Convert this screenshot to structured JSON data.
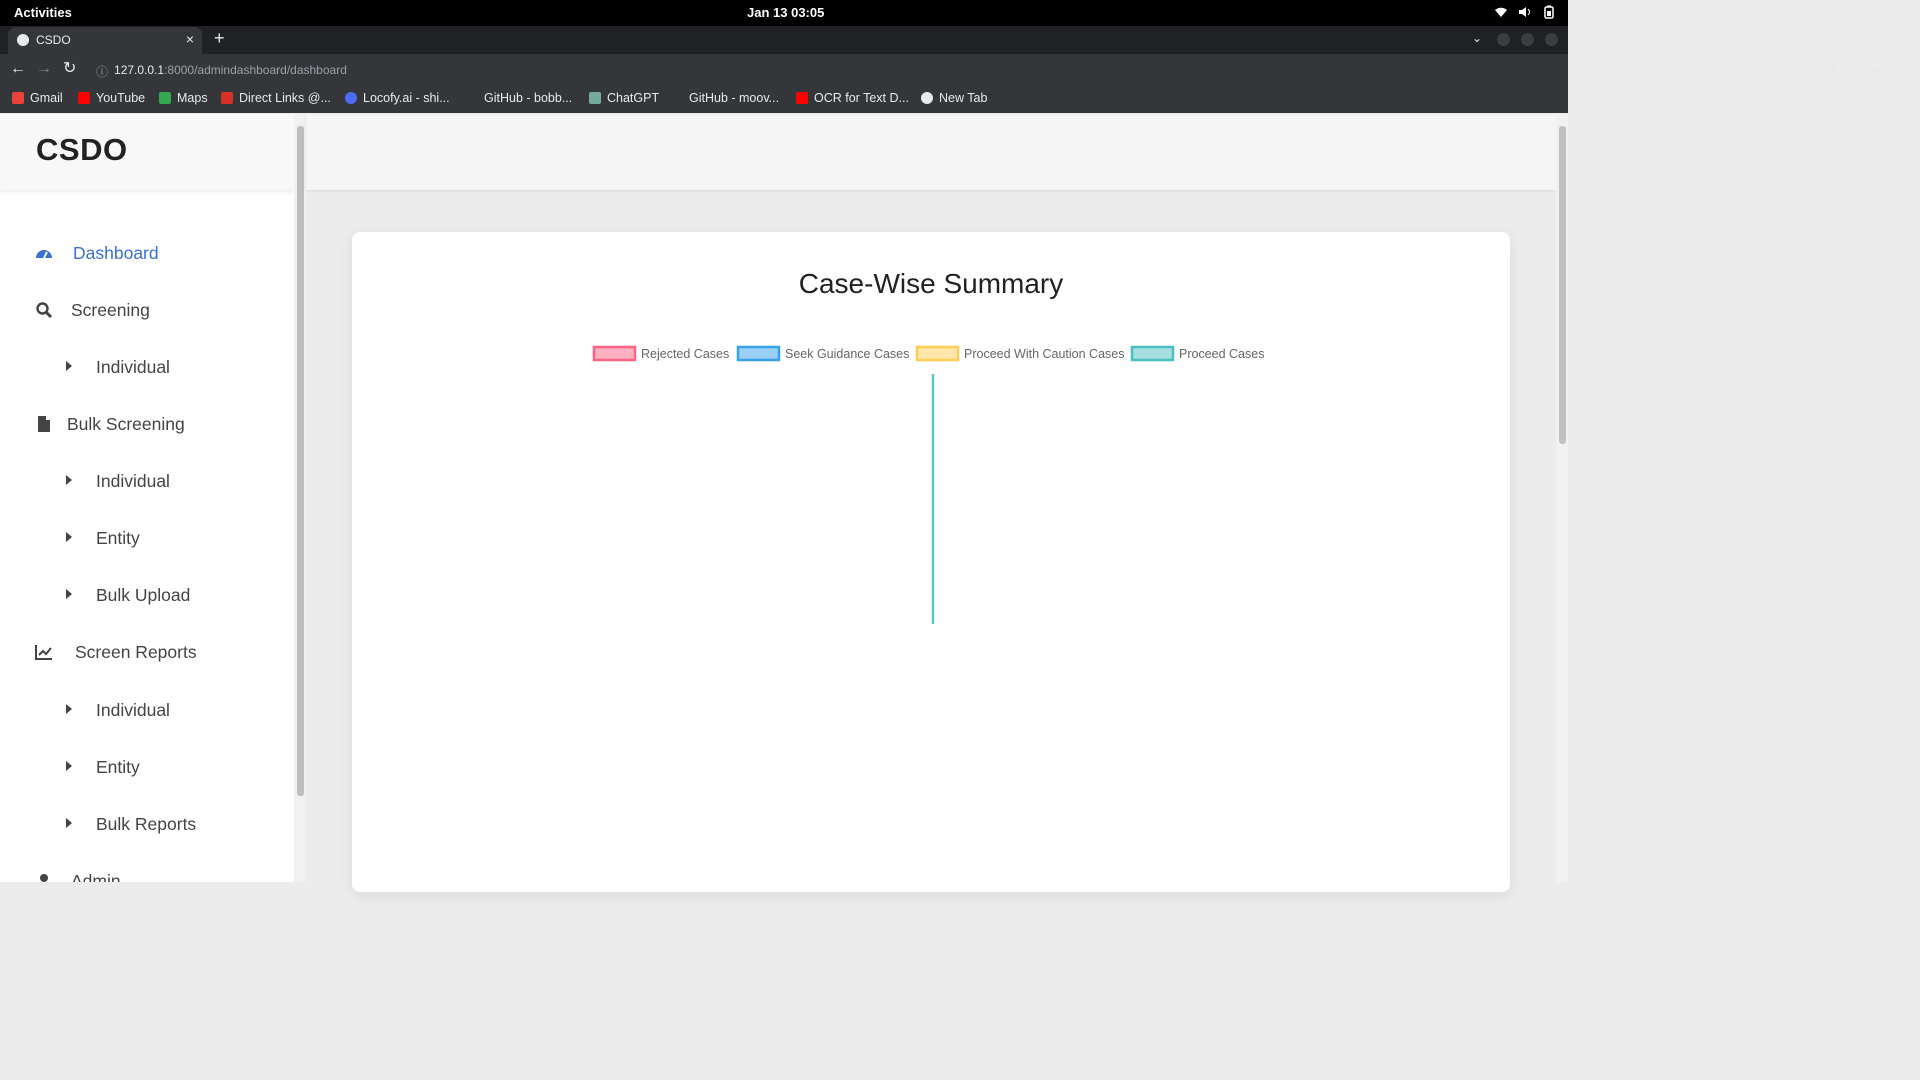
{
  "system": {
    "activities": "Activities",
    "clock": "Jan 13  03:05"
  },
  "browser": {
    "tab_title": "CSDO",
    "tab_close": "×",
    "new_tab": "+",
    "url_host": "127.0.0.1",
    "url_path": ":8000/admindashboard/dashboard",
    "bookmarks": [
      {
        "label": "Gmail",
        "color": "#ea4335"
      },
      {
        "label": "YouTube",
        "color": "#ff0000"
      },
      {
        "label": "Maps",
        "color": "#34a853"
      },
      {
        "label": "Direct Links @...",
        "color": "#d93025"
      },
      {
        "label": "Locofy.ai - shi...",
        "color": "#4a6cf7"
      },
      {
        "label": "GitHub - bobb...",
        "color": "#35363a"
      },
      {
        "label": "ChatGPT",
        "color": "#74aa9c"
      },
      {
        "label": "GitHub - moov...",
        "color": "#35363a"
      },
      {
        "label": "OCR for Text D...",
        "color": "#ff0000"
      },
      {
        "label": "New Tab",
        "color": "#e8eaed"
      }
    ]
  },
  "sidebar": {
    "brand": "CSDO",
    "items": [
      {
        "label": "Dashboard",
        "icon": "dashboard-icon",
        "active": true
      },
      {
        "label": "Screening",
        "icon": "search-icon"
      },
      {
        "label": "Individual",
        "sub": true
      },
      {
        "label": "Bulk Screening",
        "icon": "file-icon"
      },
      {
        "label": "Individual",
        "sub": true
      },
      {
        "label": "Entity",
        "sub": true
      },
      {
        "label": "Bulk Upload",
        "sub": true
      },
      {
        "label": "Screen Reports",
        "icon": "chart-line-icon"
      },
      {
        "label": "Individual",
        "sub": true
      },
      {
        "label": "Entity",
        "sub": true
      },
      {
        "label": "Bulk Reports",
        "sub": true
      },
      {
        "label": "Admin",
        "icon": "user-icon"
      }
    ],
    "active_color": "#3b6fd4"
  },
  "card": {
    "title": "Case-Wise Summary"
  },
  "chart_data": {
    "type": "bar",
    "title": "Case-Wise Summary",
    "series": [
      {
        "name": "Rejected Cases",
        "color": "#ff6384",
        "values": [
          0
        ]
      },
      {
        "name": "Seek Guidance Cases",
        "color": "#36a2eb",
        "values": [
          0
        ]
      },
      {
        "name": "Proceed With Caution Cases",
        "color": "#ffcd56",
        "values": [
          0
        ]
      },
      {
        "name": "Proceed Cases",
        "color": "#4bc0c0",
        "values": [
          1
        ]
      }
    ],
    "legend": "top",
    "grid": false
  }
}
